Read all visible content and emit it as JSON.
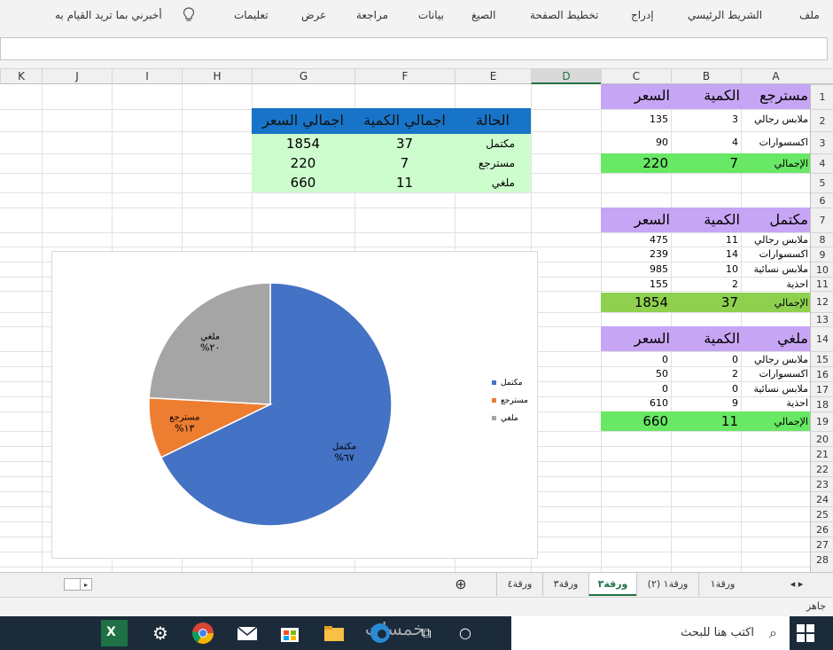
{
  "ribbon": {
    "tabs": [
      "ملف",
      "الشريط الرئيسي",
      "إدراج",
      "تخطيط الصفحة",
      "الصيغ",
      "بيانات",
      "مراجعة",
      "عرض",
      "تعليمات"
    ],
    "tell_me": "أخبرني بما تريد القيام به"
  },
  "columns": [
    "A",
    "B",
    "C",
    "D",
    "E",
    "F",
    "G",
    "H",
    "I",
    "J",
    "K"
  ],
  "rows": [
    "1",
    "2",
    "3",
    "4",
    "5",
    "6",
    "7",
    "8",
    "9",
    "10",
    "11",
    "12",
    "13",
    "14",
    "15",
    "16",
    "17",
    "18",
    "19",
    "20",
    "21",
    "22",
    "23",
    "24",
    "25",
    "26",
    "27",
    "28"
  ],
  "block_returned": {
    "headers": [
      "مسترجع",
      "الكمية",
      "السعر"
    ],
    "rows": [
      [
        "ملابس رجالي",
        "3",
        "135"
      ],
      [
        "اكسسوارات",
        "4",
        "90"
      ]
    ],
    "total": [
      "الإجمالي",
      "7",
      "220"
    ]
  },
  "block_complete": {
    "headers": [
      "مكتمل",
      "الكمية",
      "السعر"
    ],
    "rows": [
      [
        "ملابس رجالي",
        "11",
        "475"
      ],
      [
        "اكسسوارات",
        "14",
        "239"
      ],
      [
        "ملابس نسائية",
        "10",
        "985"
      ],
      [
        "احذية",
        "2",
        "155"
      ]
    ],
    "total": [
      "الإجمالي",
      "37",
      "1854"
    ]
  },
  "block_cancelled": {
    "headers": [
      "ملغي",
      "الكمية",
      "السعر"
    ],
    "rows": [
      [
        "ملابس رجالي",
        "0",
        "0"
      ],
      [
        "اكسسوارات",
        "2",
        "50"
      ],
      [
        "ملابس نسائية",
        "0",
        "0"
      ],
      [
        "احذية",
        "9",
        "610"
      ]
    ],
    "total": [
      "الإجمالي",
      "11",
      "660"
    ]
  },
  "summary": {
    "headers": [
      "الحالة",
      "اجمالي الكمية",
      "اجمالي السعر"
    ],
    "rows": [
      [
        "مكتمل",
        "37",
        "1854"
      ],
      [
        "مسترجع",
        "7",
        "220"
      ],
      [
        "ملغي",
        "11",
        "660"
      ]
    ]
  },
  "chart_data": {
    "type": "pie",
    "categories": [
      "مكتمل",
      "مسترجع",
      "ملغي"
    ],
    "values": [
      1854,
      220,
      660
    ],
    "percent_labels": [
      "%٦٧",
      "%١٣",
      "%٢٠"
    ],
    "colors": [
      "#4472c4",
      "#ed7d31",
      "#a5a5a5"
    ],
    "legend_position": "right"
  },
  "sheet_tabs": [
    "ورقة١",
    "ورقة١ (٢)",
    "ورقة٣",
    "ورقة٣",
    "ورقة٤"
  ],
  "active_tab": "ورقة٣",
  "status": "جاهز",
  "taskbar": {
    "search_placeholder": "اكتب هنا للبحث",
    "watermark": "خمسات"
  }
}
